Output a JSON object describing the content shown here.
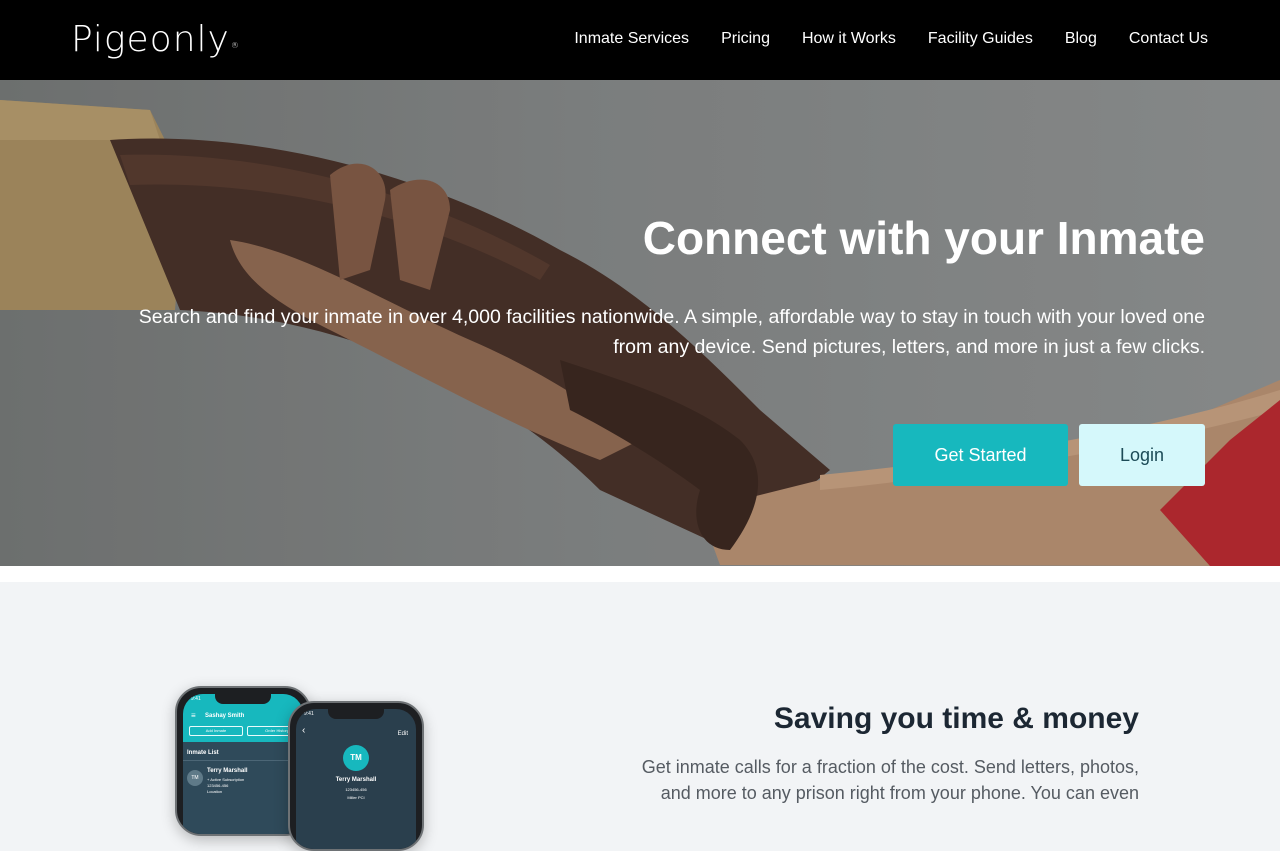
{
  "nav": {
    "logo": "Pigeonly",
    "logo_mark": "®",
    "links": [
      "Inmate Services",
      "Pricing",
      "How it Works",
      "Facility Guides",
      "Blog",
      "Contact Us"
    ]
  },
  "hero": {
    "title": "Connect with your Inmate",
    "text": "Search and find your inmate in over 4,000 facilities nationwide. A simple, affordable way to stay in touch with your loved one from any device. Send pictures, letters, and more in just a few clicks.",
    "primary_button": "Get Started",
    "secondary_button": "Login"
  },
  "feature": {
    "title": "Saving you time & money",
    "text": "Get inmate calls for a fraction of the cost. Send letters, photos, and more to any prison right from your phone. You can even"
  },
  "phone1": {
    "time": "9:41",
    "header_name": "Sashay Smith",
    "btn_add": "Add Inmate",
    "btn_order": "Order History",
    "list_label": "Inmate List",
    "avatar": "TM",
    "item_name": "Terry Marshall",
    "item_line1": "+ Active Subscription",
    "item_line2": "123456-456",
    "item_line3": "Location"
  },
  "phone2": {
    "time": "9:41",
    "edit": "Edit",
    "back": "‹",
    "avatar": "TM",
    "name": "Terry Marshall",
    "id": "123456-456",
    "location": "Miller PCI"
  },
  "colors": {
    "accent": "#17b8be",
    "accent_light": "#d5f8fb",
    "nav_bg": "#000000",
    "section_bg": "#f2f4f6"
  }
}
